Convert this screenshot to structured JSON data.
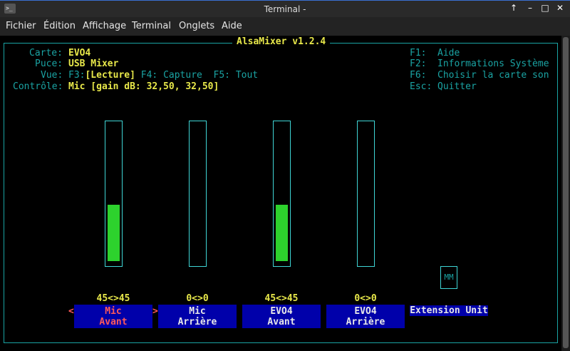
{
  "window": {
    "title": "Terminal -",
    "icons": [
      "terminal-icon",
      "keep-above-icon",
      "minimize-icon",
      "maximize-icon",
      "close-icon"
    ]
  },
  "menu": [
    "Fichier",
    "Édition",
    "Affichage",
    "Terminal",
    "Onglets",
    "Aide"
  ],
  "mixer": {
    "title": "AlsaMixer v1.2.4",
    "info": {
      "carte_label": "Carte:",
      "carte": "EVO4",
      "puce_label": "Puce:",
      "puce": "USB Mixer",
      "vue_label": "Vue:",
      "vue_f3": "F3:",
      "vue_lecture": "[Lecture]",
      "vue_rest": " F4: Capture  F5: Tout",
      "controle_label": "Contrôle:",
      "controle": "Mic [gain dB: 32,50, 32,50]"
    },
    "help": [
      {
        "key": "F1:",
        "text": "Aide"
      },
      {
        "key": "F2:",
        "text": "Informations Système"
      },
      {
        "key": "F6:",
        "text": "Choisir la carte son"
      },
      {
        "key": "Esc:",
        "text": "Quitter"
      }
    ],
    "channels": [
      {
        "name1": "Mic",
        "name2": "Avant",
        "value": "45<>45",
        "level": 45,
        "selected": true
      },
      {
        "name1": "Mic",
        "name2": "Arrière",
        "value": "0<>0",
        "level": 0,
        "selected": false
      },
      {
        "name1": "EVO4",
        "name2": "Avant",
        "value": "45<>45",
        "level": 45,
        "selected": false
      },
      {
        "name1": "EVO4",
        "name2": "Arrière",
        "value": "0<>0",
        "level": 0,
        "selected": false
      }
    ],
    "extension": {
      "label": "Extension Unit",
      "switch": "MM"
    },
    "arrows": {
      "left": "<",
      "right": ">"
    },
    "colors": {
      "accent": "#1aa3a3",
      "highlight": "#e8e84a",
      "bar": "#2dd22d",
      "label_bg": "#0000aa",
      "selected": "#ff5a5a"
    }
  }
}
